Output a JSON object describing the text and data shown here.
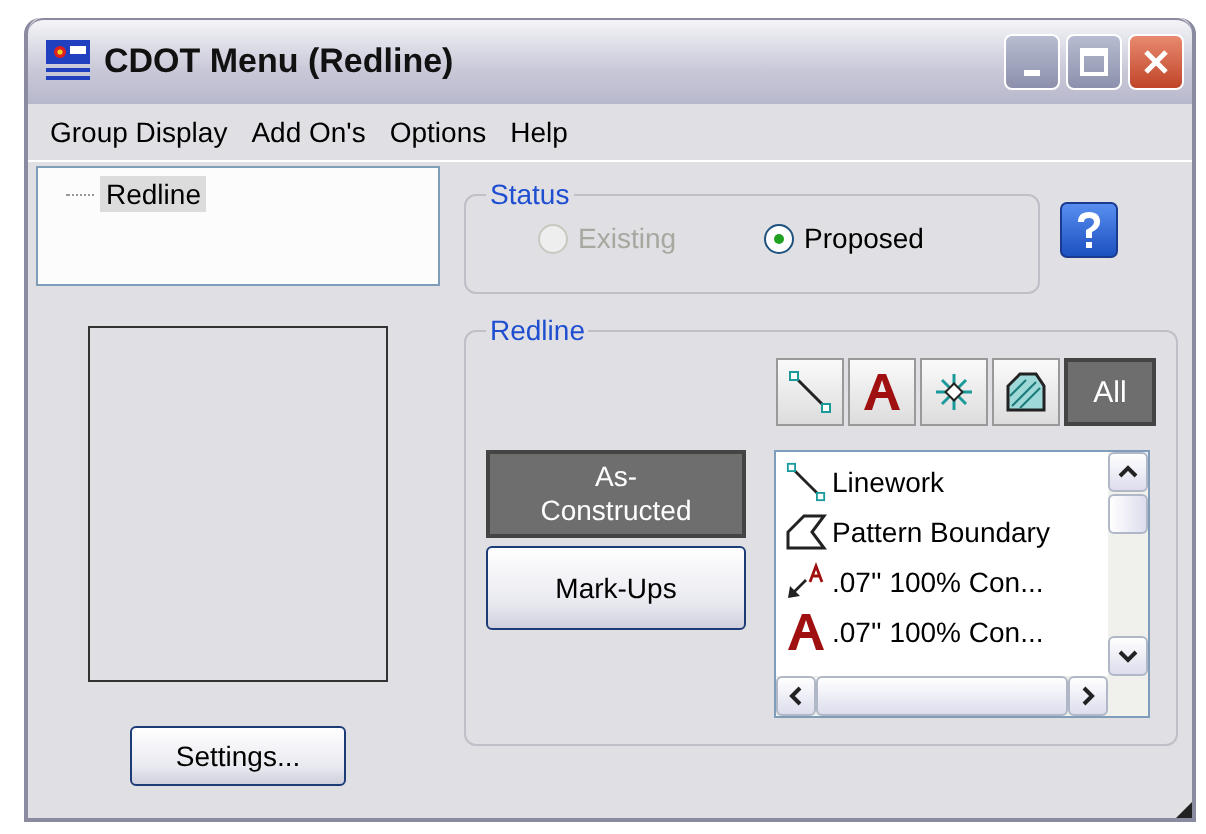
{
  "window": {
    "title": "CDOT Menu (Redline)"
  },
  "menu": [
    "Group Display",
    "Add On's",
    "Options",
    "Help"
  ],
  "tree": [
    {
      "label": "Redline",
      "selected": true
    }
  ],
  "settings_button": "Settings...",
  "status": {
    "title": "Status",
    "options": [
      {
        "label": "Existing",
        "selected": false,
        "disabled": true
      },
      {
        "label": "Proposed",
        "selected": true,
        "disabled": false
      }
    ]
  },
  "redline": {
    "title": "Redline",
    "filters": [
      {
        "kind": "line",
        "selected": false
      },
      {
        "kind": "text",
        "selected": false
      },
      {
        "kind": "cell",
        "selected": false
      },
      {
        "kind": "pattern",
        "selected": false
      },
      {
        "kind": "all",
        "label": "All",
        "selected": true
      }
    ],
    "modes": [
      {
        "label": "As-\nConstructed",
        "selected": true
      },
      {
        "label": "Mark-Ups",
        "selected": false
      }
    ],
    "items": [
      {
        "kind": "line",
        "label": "Linework"
      },
      {
        "kind": "pattern",
        "label": "Pattern Boundary"
      },
      {
        "kind": "leader",
        "label": ".07'' 100% Con..."
      },
      {
        "kind": "text",
        "label": ".07'' 100% Con..."
      }
    ]
  }
}
